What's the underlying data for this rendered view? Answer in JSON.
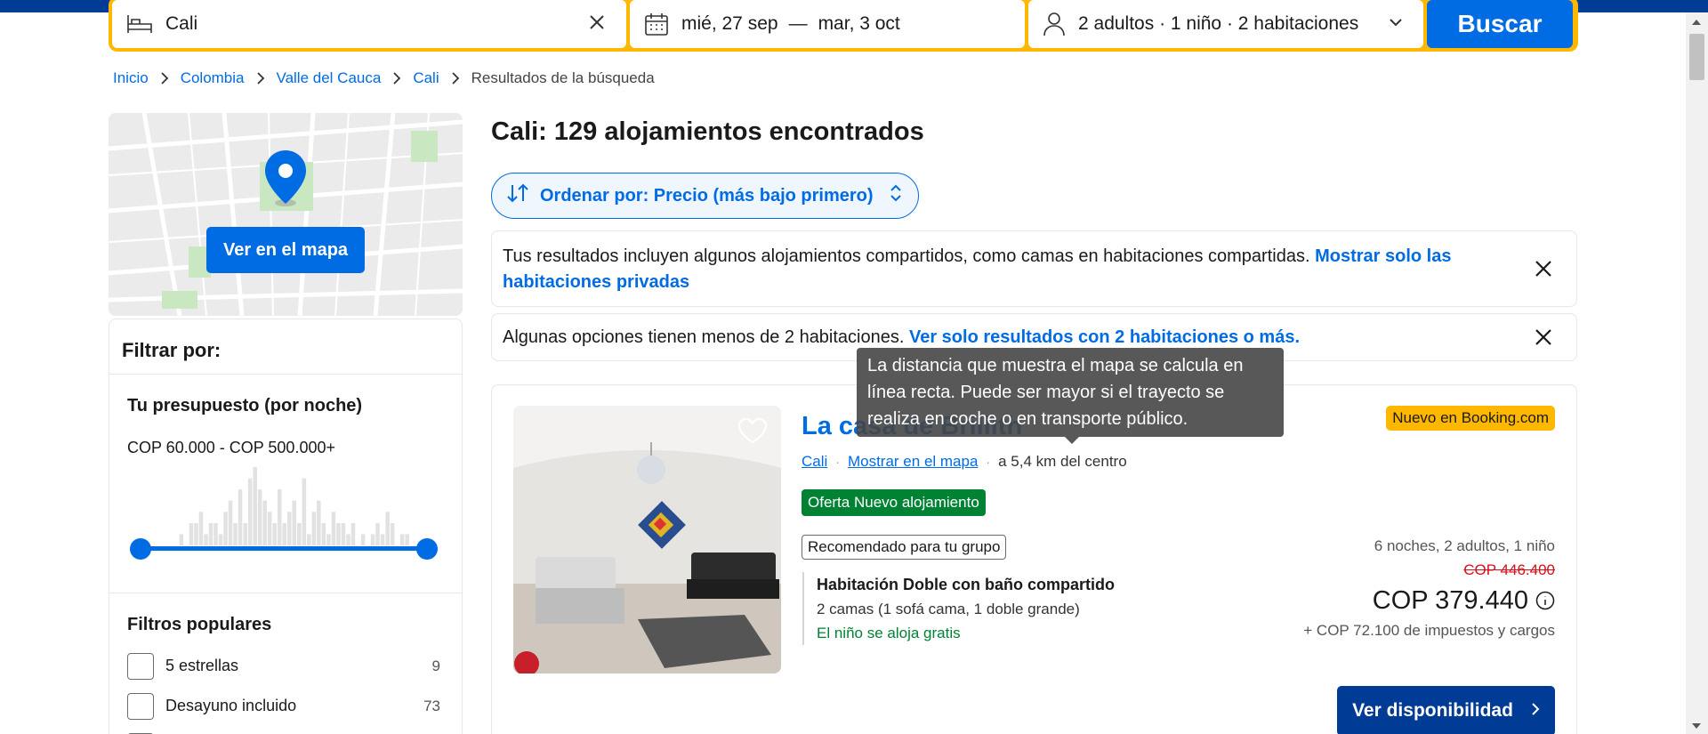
{
  "search": {
    "destination": "Cali",
    "checkin": "mié, 27 sep",
    "dash": "—",
    "checkout": "mar, 3 oct",
    "guests": "2 adultos · 1 niño · 2 habitaciones",
    "button": "Buscar"
  },
  "breadcrumb": {
    "items": [
      "Inicio",
      "Colombia",
      "Valle del Cauca",
      "Cali"
    ],
    "current": "Resultados de la búsqueda"
  },
  "map": {
    "button": "Ver en el mapa"
  },
  "filters": {
    "title": "Filtrar por:",
    "budget_title": "Tu presupuesto (por noche)",
    "budget_range": "COP 60.000 - COP 500.000+",
    "histogram": [
      0,
      0,
      0,
      0,
      0,
      0,
      0,
      0,
      1,
      0,
      2,
      2,
      3,
      1,
      2,
      2,
      1,
      3,
      4,
      2,
      5,
      2,
      6,
      7,
      5,
      4,
      3,
      2,
      5,
      2,
      3,
      4,
      2,
      6,
      1,
      3,
      4,
      2,
      1,
      3,
      2,
      2,
      1,
      2,
      0,
      1,
      0,
      1,
      2,
      1,
      3,
      2,
      0,
      1,
      1,
      0,
      0,
      0
    ],
    "popular_title": "Filtros populares",
    "popular": [
      {
        "label": "5 estrellas",
        "count": "9"
      },
      {
        "label": "Desayuno incluido",
        "count": "73"
      }
    ]
  },
  "results": {
    "title": "Cali: 129 alojamientos encontrados",
    "sort": "Ordenar por: Precio (más bajo primero)",
    "banner1_text": "Tus resultados incluyen algunos alojamientos compartidos, como camas en habitaciones compartidas. ",
    "banner1_link": "Mostrar solo las habitaciones privadas",
    "banner2_text": "Algunas opciones tienen menos de 2 habitaciones. ",
    "banner2_link": "Ver solo resultados con 2 habitaciones o más."
  },
  "property": {
    "name": "La casa de Brillith",
    "badge": "Nuevo en Booking.com",
    "city": "Cali",
    "show_map": "Mostrar en el mapa",
    "distance": "a 5,4 km del centro",
    "deal": "Oferta Nuevo alojamiento",
    "recommended": "Recomendado para tu grupo",
    "room_title": "Habitación Doble con baño compartido",
    "room_beds": "2 camas (1 sofá cama, 1 doble grande)",
    "kid_note": "El niño se aloja gratis",
    "stay": "6 noches, 2 adultos, 1 niño",
    "old_price": "COP 446.400",
    "price": "COP 379.440",
    "taxes": "+ COP 72.100 de impuestos y cargos",
    "cta": "Ver disponibilidad"
  },
  "tooltip": "La distancia que muestra el mapa se calcula en línea recta. Puede ser mayor si el trayecto se realiza en coche o en transporte público.",
  "colors": {
    "brand_blue": "#003b95",
    "action_blue": "#006ce4",
    "search_yellow": "#ffb700",
    "deal_green": "#008234",
    "strike_red": "#d4111e"
  }
}
